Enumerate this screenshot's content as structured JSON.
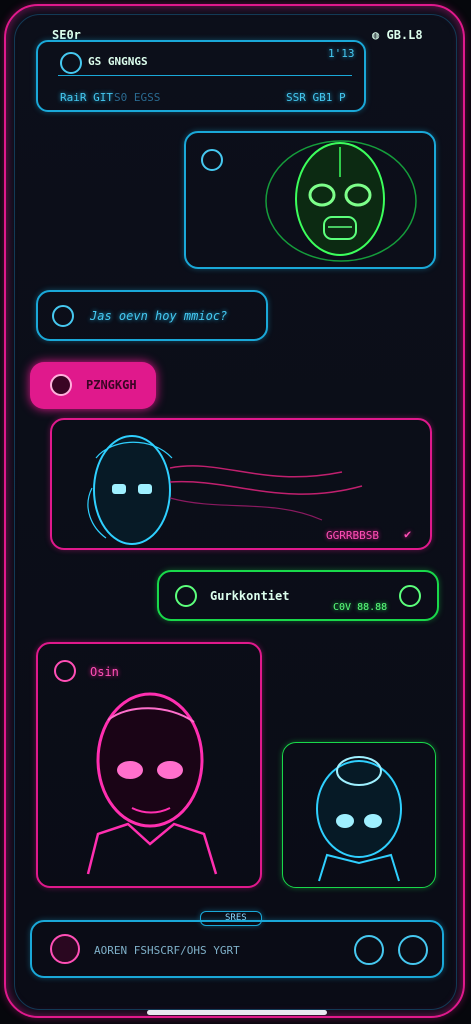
{
  "status_bar": {
    "time": "SE0r",
    "right": "GB.L8"
  },
  "header": {
    "title": "GS GNGNGS",
    "badge": "1'13",
    "sub_left": "RaiR GIT",
    "sub_mid": "S0 EGSS",
    "sub_right": "SSR GB1 P"
  },
  "messages": {
    "m2_text": "Jas oevn hoy mmioc?",
    "m3_name": "PZNGKGH",
    "m4_footer": "GGRRBBSB",
    "m5_text": "Gurkkontiet",
    "m5_time": "C0V 88.88",
    "m6_name": "Osin"
  },
  "composer": {
    "tag": "SRES",
    "placeholder": "AOREN FSHSCRF/OHS YGRT"
  },
  "colors": {
    "cyan": "#1aa8d8",
    "pink": "#e0198c",
    "green": "#19d84a",
    "background": "#0a0c16"
  }
}
